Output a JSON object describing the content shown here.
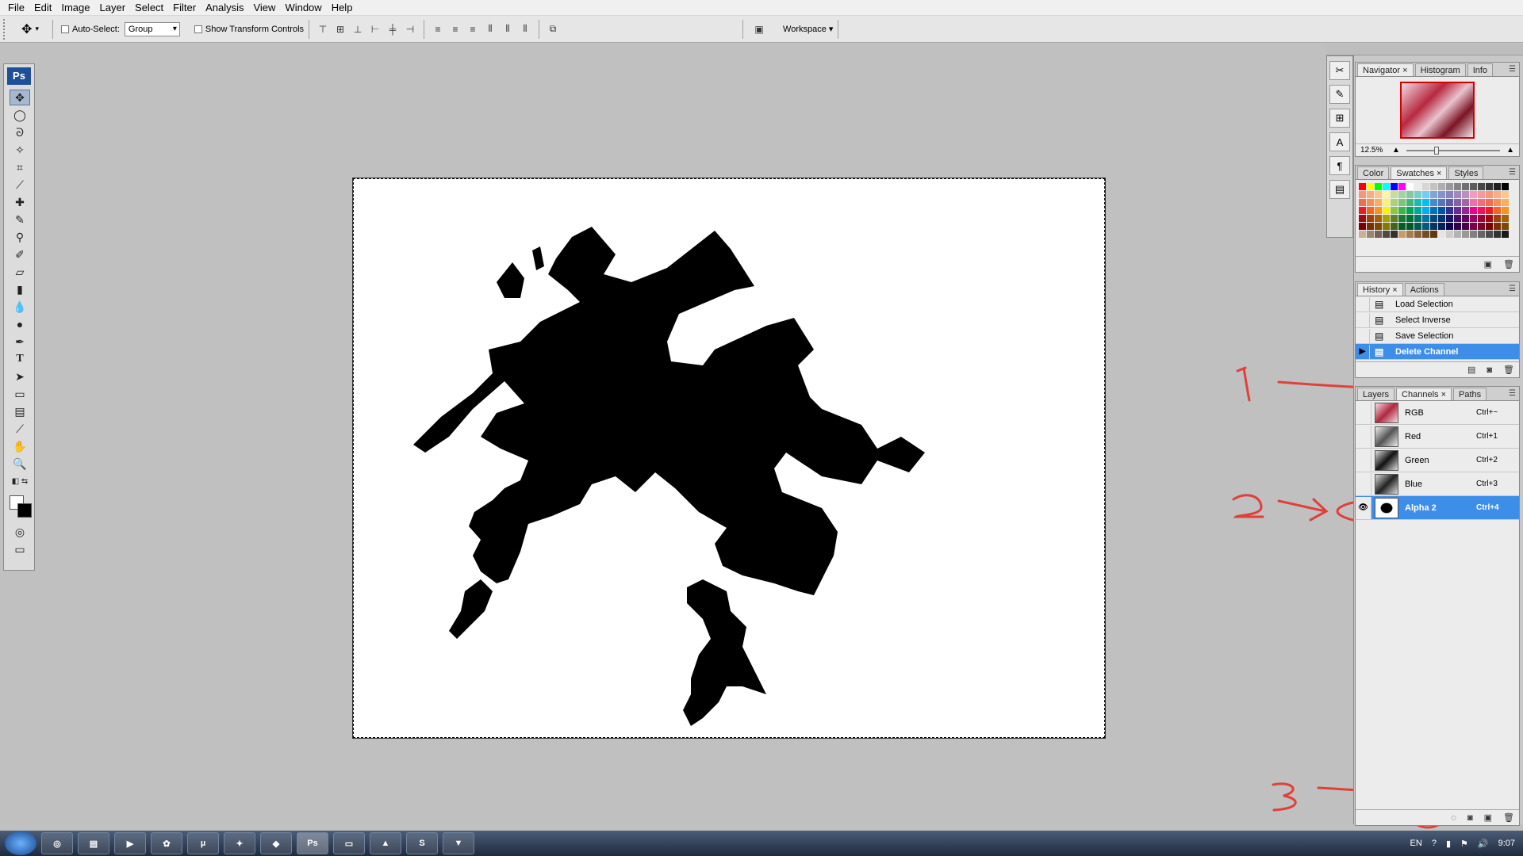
{
  "menu": [
    "File",
    "Edit",
    "Image",
    "Layer",
    "Select",
    "Filter",
    "Analysis",
    "View",
    "Window",
    "Help"
  ],
  "options": {
    "auto_select_label": "Auto-Select:",
    "auto_select_value": "Group",
    "show_transform_label": "Show Transform Controls",
    "workspace_label": "Workspace ▾"
  },
  "toolbox": {
    "logo": "Ps",
    "tools": [
      "move-tool",
      "marquee-tool",
      "lasso-tool",
      "magic-wand-tool",
      "crop-tool",
      "eyedropper-tool",
      "healing-brush-tool",
      "brush-tool",
      "clone-stamp-tool",
      "history-brush-tool",
      "eraser-tool",
      "gradient-tool",
      "blur-tool",
      "dodge-tool",
      "pen-tool",
      "type-tool",
      "path-selection-tool",
      "shape-tool",
      "notes-tool",
      "eyedropper-3d-tool",
      "hand-tool",
      "zoom-tool"
    ]
  },
  "navigator": {
    "tabs": [
      "Navigator",
      "Histogram",
      "Info"
    ],
    "zoom": "12.5%"
  },
  "swatches_panel": {
    "tabs": [
      "Color",
      "Swatches",
      "Styles"
    ]
  },
  "history": {
    "tabs": [
      "History",
      "Actions"
    ],
    "items": [
      "Load Selection",
      "Select Inverse",
      "Save Selection",
      "Delete Channel"
    ],
    "selected_index": 3
  },
  "channels": {
    "tabs": [
      "Layers",
      "Channels",
      "Paths"
    ],
    "rows": [
      {
        "name": "RGB",
        "shortcut": "Ctrl+~"
      },
      {
        "name": "Red",
        "shortcut": "Ctrl+1"
      },
      {
        "name": "Green",
        "shortcut": "Ctrl+2"
      },
      {
        "name": "Blue",
        "shortcut": "Ctrl+3"
      },
      {
        "name": "Alpha 2",
        "shortcut": "Ctrl+4"
      }
    ],
    "selected": "Alpha 2"
  },
  "annotations": [
    "1",
    "2",
    "3"
  ],
  "taskbar": {
    "language": "EN",
    "time": "9:07",
    "apps": [
      "chrome",
      "explorer",
      "media",
      "app",
      "utorrent",
      "app2",
      "app3",
      "photoshop",
      "monitor",
      "photos",
      "skype",
      "vlc"
    ]
  },
  "colors": {
    "selection": "#3d8ee8",
    "annotation": "#e0403a",
    "ps_blue": "#1d4f9b"
  }
}
